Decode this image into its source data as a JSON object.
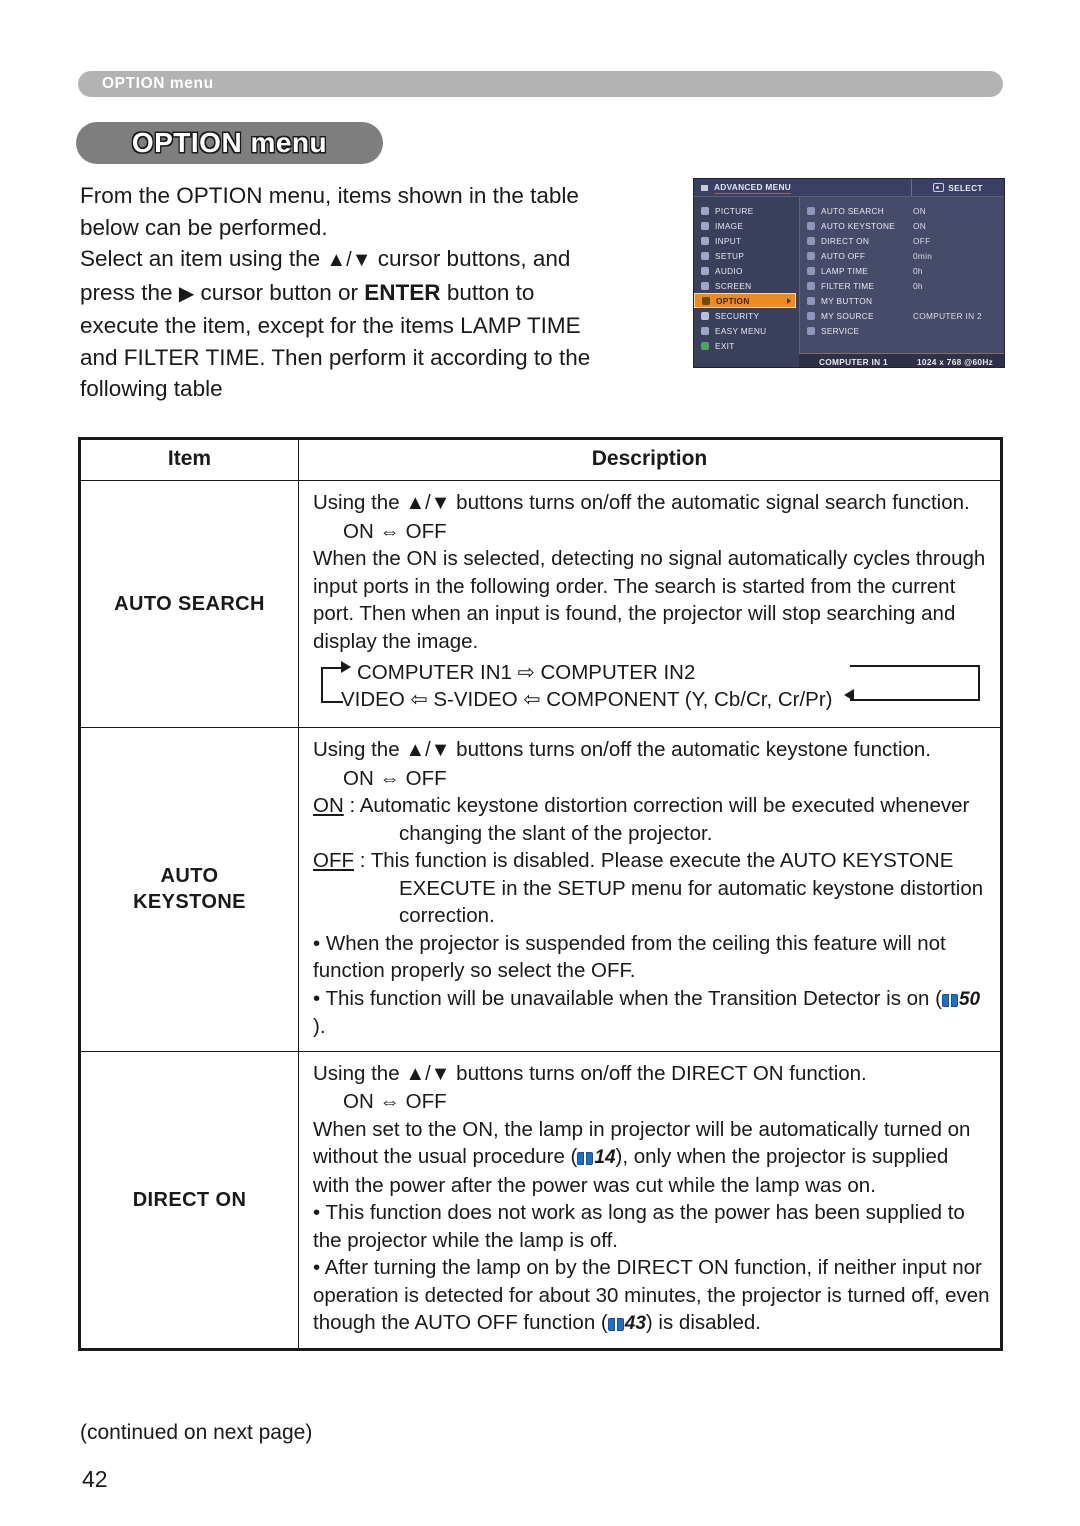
{
  "running_header": {
    "label": "OPTION menu"
  },
  "section_title": {
    "label": "OPTION menu"
  },
  "intro": {
    "line1": "From the OPTION menu, items shown in the table",
    "line2": "below can be performed.",
    "line3_a": "Select an item using the ",
    "line3_arrows": "▲/▼",
    "line3_b": " cursor buttons, and",
    "line4_a": "press the ",
    "line4_arrow": "▶",
    "line4_b": " cursor button or ",
    "line4_bold": "ENTER",
    "line4_c": " button to",
    "line5": "execute the item, except for the items LAMP TIME",
    "line6": "and FILTER TIME. Then perform it according to the",
    "line7": "following table"
  },
  "osd": {
    "titlebar": {
      "title": "ADVANCED MENU",
      "select_label": "SELECT"
    },
    "left_menu": [
      {
        "label": "PICTURE",
        "icon": "brightness-icon",
        "selected": false
      },
      {
        "label": "IMAGE",
        "icon": "image-icon",
        "selected": false
      },
      {
        "label": "INPUT",
        "icon": "input-icon",
        "selected": false
      },
      {
        "label": "SETUP",
        "icon": "setup-icon",
        "selected": false
      },
      {
        "label": "AUDIO",
        "icon": "note-icon",
        "selected": false
      },
      {
        "label": "SCREEN",
        "icon": "screen-icon",
        "selected": false
      },
      {
        "label": "OPTION",
        "icon": "option-icon",
        "selected": true
      },
      {
        "label": "SECURITY",
        "icon": "shield-icon",
        "selected": false
      },
      {
        "label": "EASY MENU",
        "icon": "easy-menu-icon",
        "selected": false
      },
      {
        "label": "EXIT",
        "icon": "exit-icon",
        "selected": false
      }
    ],
    "items": [
      {
        "label": "AUTO SEARCH",
        "value": "ON",
        "icon": "search-icon"
      },
      {
        "label": "AUTO KEYSTONE",
        "value": "ON",
        "icon": "keystone-icon"
      },
      {
        "label": "DIRECT ON",
        "value": "OFF",
        "icon": "power-icon"
      },
      {
        "label": "AUTO OFF",
        "value": "0min",
        "icon": "clock-icon"
      },
      {
        "label": "LAMP TIME",
        "value": "0h",
        "icon": "lamp-icon"
      },
      {
        "label": "FILTER TIME",
        "value": "0h",
        "icon": "filter-icon"
      },
      {
        "label": "MY BUTTON",
        "value": "",
        "icon": "button-icon"
      },
      {
        "label": "MY SOURCE",
        "value": "COMPUTER IN 2",
        "icon": "source-icon"
      },
      {
        "label": "SERVICE",
        "value": "",
        "icon": "wrench-icon"
      }
    ],
    "status": {
      "port": "COMPUTER IN 1",
      "resolution": "1024 x 768 @60Hz"
    }
  },
  "table": {
    "headers": {
      "item": "Item",
      "description": "Description"
    },
    "rows": [
      {
        "item": "AUTO SEARCH",
        "desc": {
          "p1_a": "Using the ",
          "p1_arrows": "▲/▼",
          "p1_b": " buttons turns on/off the automatic signal search function.",
          "toggle": "ON ⇔ OFF",
          "p2": "When the ON is selected, detecting no signal automatically cycles through input ports in the following order. The search is started from the current port. Then when an input is found, the projector will stop searching and display the image.",
          "cycle_line1": "COMPUTER IN1  ⇨  COMPUTER IN2",
          "cycle_line2": "VIDEO ⇦ S-VIDEO ⇦ COMPONENT (Y, Cb/Cr, Cr/Pr)"
        }
      },
      {
        "item_line1": "AUTO",
        "item_line2": "KEYSTONE",
        "desc": {
          "p1_a": "Using the ",
          "p1_arrows": "▲/▼",
          "p1_b": " buttons turns on/off the automatic keystone function.",
          "toggle": "ON ⇔ OFF",
          "on_label": "ON",
          "on_text": " : Automatic keystone distortion correction will be executed whenever changing the slant of the projector.",
          "off_label": "OFF",
          "off_text": " : This function is disabled. Please execute the AUTO KEYSTONE EXECUTE in the SETUP menu for automatic keystone distortion correction.",
          "bullet1": "• When the projector is suspended from the ceiling this feature will not function properly so select the OFF.",
          "bullet2_a": "• This function will be unavailable when the Transition Detector is on (",
          "bullet2_ref": "50",
          "bullet2_b": ")."
        }
      },
      {
        "item": "DIRECT ON",
        "desc": {
          "p1_a": "Using the ",
          "p1_arrows": "▲/▼",
          "p1_b": " buttons turns on/off the DIRECT ON function.",
          "toggle": "ON ⇔ OFF",
          "p2_a": "When set to the ON, the lamp in projector will be automatically turned on without the usual procedure (",
          "p2_ref": "14",
          "p2_b": "), only when the projector is supplied with the power after the power was cut while the lamp was on.",
          "bullet1": "• This function does not work as long as the power has been supplied to the projector while the lamp is off.",
          "bullet2_a": "• After turning the lamp on by the DIRECT ON function, if neither input nor operation is detected for about 30 minutes, the projector is turned off, even though the AUTO OFF function (",
          "bullet2_ref": "43",
          "bullet2_b": ") is disabled."
        }
      }
    ]
  },
  "footer": {
    "continued": "(continued on next page)",
    "page_number": "42"
  }
}
